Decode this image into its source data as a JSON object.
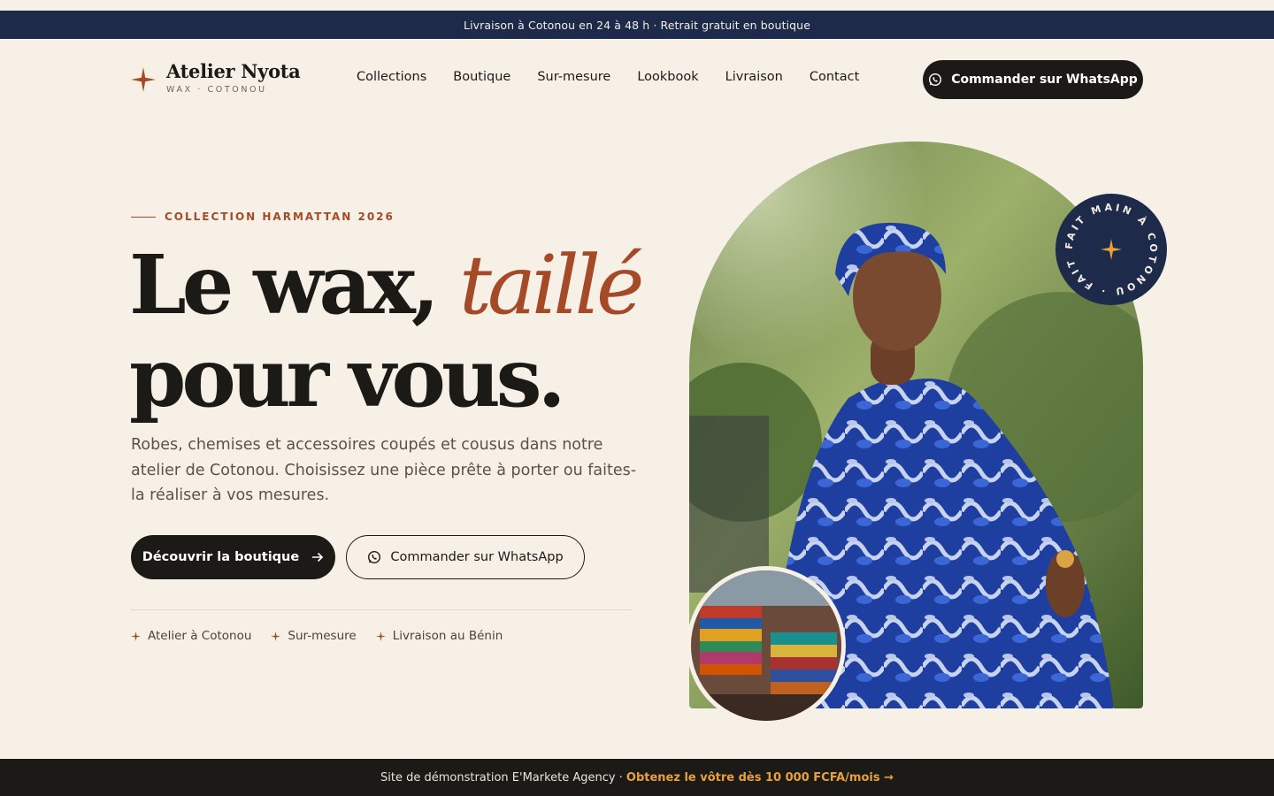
{
  "announcement": "Livraison à Cotonou en 24 à 48 h · Retrait gratuit en boutique",
  "brand": {
    "name": "Atelier Nyota",
    "tagline": "WAX · COTONOU"
  },
  "nav": [
    "Collections",
    "Boutique",
    "Sur-mesure",
    "Lookbook",
    "Livraison",
    "Contact"
  ],
  "header_cta": "Commander sur WhatsApp",
  "hero": {
    "eyebrow": "COLLECTION HARMATTAN 2026",
    "title_part1": "Le wax, ",
    "title_accent": "taillé",
    "title_part2": "pour vous.",
    "description": "Robes, chemises et accessoires coupés et cousus dans notre atelier de Cotonou. Choisissez une pièce prête à porter ou faites-la réaliser à vos mesures.",
    "primary_cta": "Découvrir la boutique",
    "secondary_cta": "Commander sur WhatsApp",
    "features": [
      "Atelier à Cotonou",
      "Sur-mesure",
      "Livraison au Bénin"
    ],
    "badge_text": "FAIT MAIN À COTONOU · FAIT MAIN "
  },
  "footer": {
    "text": "Site de démonstration E'Markete Agency ·",
    "cta": "Obtenez le vôtre dès 10 000 FCFA/mois →"
  },
  "colors": {
    "navy": "#1e2a4a",
    "accent": "#a54a27",
    "dark": "#1c1a17",
    "cream": "#f7f0e7",
    "gold": "#e8a13a"
  }
}
